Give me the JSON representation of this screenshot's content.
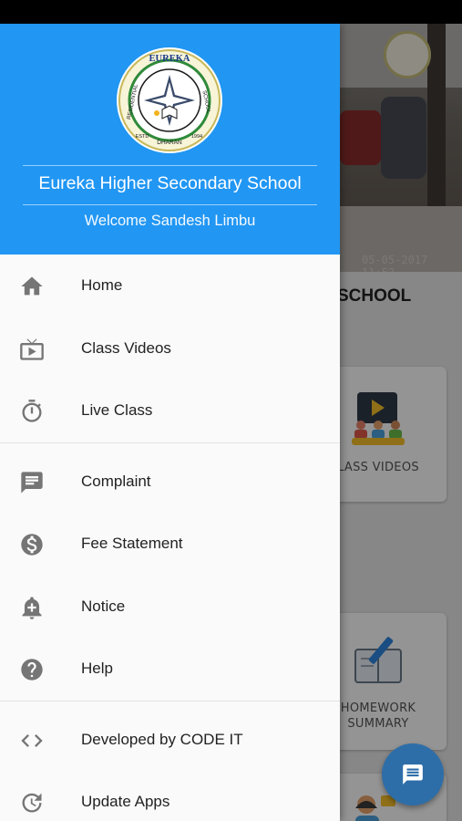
{
  "drawer": {
    "school_name": "Eureka Higher Secondary School",
    "welcome": "Welcome Sandesh Limbu",
    "logo": {
      "top_text": "EUREKA",
      "left_text": "RESIDENTIAL",
      "right_text": "SCHOOL",
      "bottom_text": "DHARAN",
      "estd_left": "ESTD",
      "estd_right": "1994"
    },
    "sections": [
      [
        {
          "label": "Home",
          "icon": "home-icon"
        },
        {
          "label": "Class Videos",
          "icon": "tv-play-icon"
        },
        {
          "label": "Live Class",
          "icon": "timer-icon"
        }
      ],
      [
        {
          "label": "Complaint",
          "icon": "chat-bubble-icon"
        },
        {
          "label": "Fee Statement",
          "icon": "dollar-icon"
        },
        {
          "label": "Notice",
          "icon": "notification-add-icon"
        },
        {
          "label": "Help",
          "icon": "help-icon"
        }
      ],
      [
        {
          "label": "Developed by CODE IT",
          "icon": "code-icon"
        },
        {
          "label": "Update Apps",
          "icon": "update-icon"
        }
      ]
    ]
  },
  "background": {
    "photo_timestamp": "05-05-2017 11:52",
    "title_fragment": "SCHOOL",
    "card_class_videos": "LASS VIDEOS",
    "card_homework_line1": "HOMEWORK",
    "card_homework_line2": "SUMMARY"
  },
  "colors": {
    "header": "#2196f3",
    "fab": "#2e6ea8"
  }
}
